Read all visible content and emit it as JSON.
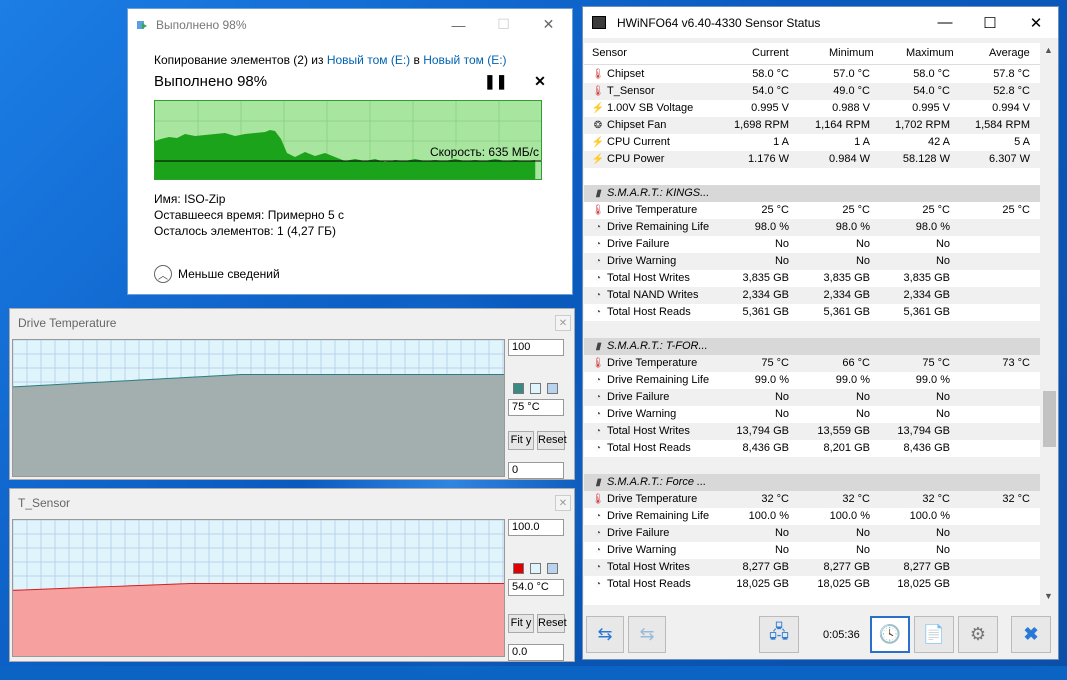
{
  "copy_dialog": {
    "title": "Выполнено 98%",
    "copy_prefix": "Копирование элементов (2) из ",
    "source": "Новый том (E:)",
    "to": " в ",
    "dest": "Новый том (E:)",
    "status": "Выполнено 98%",
    "speed": "Скорость: 635 МБ/с",
    "name_label": "Имя:",
    "name_value": "ISO-Zip",
    "time_label": "Оставшееся время:",
    "time_value": "Примерно 5 с",
    "items_label": "Осталось элементов:",
    "items_value": "1 (4,27 ГБ)",
    "less_details": "Меньше сведений",
    "progress_fraction": 0.98,
    "colors": {
      "fill": "#1ba31b",
      "bg": "#a8e6a0"
    }
  },
  "graph_drive": {
    "title": "Drive Temperature",
    "max": "100",
    "current": "75 °C",
    "min": "0",
    "fit_label": "Fit y",
    "reset_label": "Reset",
    "colors": {
      "fill": "#a3aeae",
      "line": "#2d7f7f",
      "swatch": "#3a8a84"
    }
  },
  "graph_tsensor": {
    "title": "T_Sensor",
    "max": "100.0",
    "current": "54.0 °C",
    "min": "0.0",
    "fit_label": "Fit y",
    "reset_label": "Reset",
    "colors": {
      "fill": "#f7a0a0",
      "line": "#d02020",
      "swatch": "#e00000"
    }
  },
  "hwinfo": {
    "title": "HWiNFO64 v6.40-4330 Sensor Status",
    "columns": [
      "Sensor",
      "Current",
      "Minimum",
      "Maximum",
      "Average"
    ],
    "rows": [
      {
        "icon": "thermometer-icon",
        "name": "Chipset",
        "cur": "58.0 °C",
        "min": "57.0 °C",
        "max": "58.0 °C",
        "avg": "57.8 °C"
      },
      {
        "icon": "thermometer-icon",
        "name": "T_Sensor",
        "cur": "54.0 °C",
        "min": "49.0 °C",
        "max": "54.0 °C",
        "avg": "52.8 °C"
      },
      {
        "icon": "bolt-icon",
        "name": "1.00V SB Voltage",
        "cur": "0.995 V",
        "min": "0.988 V",
        "max": "0.995 V",
        "avg": "0.994 V"
      },
      {
        "icon": "fan-icon",
        "name": "Chipset Fan",
        "cur": "1,698 RPM",
        "min": "1,164 RPM",
        "max": "1,702 RPM",
        "avg": "1,584 RPM"
      },
      {
        "icon": "bolt-icon",
        "name": "CPU Current",
        "cur": "1 A",
        "min": "1 A",
        "max": "42 A",
        "avg": "5 A"
      },
      {
        "icon": "bolt-icon",
        "name": "CPU Power",
        "cur": "1.176 W",
        "min": "0.984 W",
        "max": "58.128 W",
        "avg": "6.307 W"
      },
      {
        "blank": true
      },
      {
        "group": true,
        "icon": "drive-icon",
        "name": "S.M.A.R.T.: KINGS..."
      },
      {
        "icon": "thermometer-icon",
        "name": "Drive Temperature",
        "cur": "25 °C",
        "min": "25 °C",
        "max": "25 °C",
        "avg": "25 °C"
      },
      {
        "icon": "gauge-icon",
        "name": "Drive Remaining Life",
        "cur": "98.0 %",
        "min": "98.0 %",
        "max": "98.0 %",
        "avg": ""
      },
      {
        "icon": "gauge-icon",
        "name": "Drive Failure",
        "cur": "No",
        "min": "No",
        "max": "No",
        "avg": ""
      },
      {
        "icon": "gauge-icon",
        "name": "Drive Warning",
        "cur": "No",
        "min": "No",
        "max": "No",
        "avg": ""
      },
      {
        "icon": "gauge-icon",
        "name": "Total Host Writes",
        "cur": "3,835 GB",
        "min": "3,835 GB",
        "max": "3,835 GB",
        "avg": ""
      },
      {
        "icon": "gauge-icon",
        "name": "Total NAND Writes",
        "cur": "2,334 GB",
        "min": "2,334 GB",
        "max": "2,334 GB",
        "avg": ""
      },
      {
        "icon": "gauge-icon",
        "name": "Total Host Reads",
        "cur": "5,361 GB",
        "min": "5,361 GB",
        "max": "5,361 GB",
        "avg": ""
      },
      {
        "blank": true
      },
      {
        "group": true,
        "icon": "drive-icon",
        "name": "S.M.A.R.T.: T-FOR..."
      },
      {
        "icon": "thermometer-icon",
        "name": "Drive Temperature",
        "cur": "75 °C",
        "min": "66 °C",
        "max": "75 °C",
        "avg": "73 °C"
      },
      {
        "icon": "gauge-icon",
        "name": "Drive Remaining Life",
        "cur": "99.0 %",
        "min": "99.0 %",
        "max": "99.0 %",
        "avg": ""
      },
      {
        "icon": "gauge-icon",
        "name": "Drive Failure",
        "cur": "No",
        "min": "No",
        "max": "No",
        "avg": ""
      },
      {
        "icon": "gauge-icon",
        "name": "Drive Warning",
        "cur": "No",
        "min": "No",
        "max": "No",
        "avg": ""
      },
      {
        "icon": "gauge-icon",
        "name": "Total Host Writes",
        "cur": "13,794 GB",
        "min": "13,559 GB",
        "max": "13,794 GB",
        "avg": ""
      },
      {
        "icon": "gauge-icon",
        "name": "Total Host Reads",
        "cur": "8,436 GB",
        "min": "8,201 GB",
        "max": "8,436 GB",
        "avg": ""
      },
      {
        "blank": true
      },
      {
        "group": true,
        "icon": "drive-icon",
        "name": "S.M.A.R.T.: Force ..."
      },
      {
        "icon": "thermometer-icon",
        "name": "Drive Temperature",
        "cur": "32 °C",
        "min": "32 °C",
        "max": "32 °C",
        "avg": "32 °C"
      },
      {
        "icon": "gauge-icon",
        "name": "Drive Remaining Life",
        "cur": "100.0 %",
        "min": "100.0 %",
        "max": "100.0 %",
        "avg": ""
      },
      {
        "icon": "gauge-icon",
        "name": "Drive Failure",
        "cur": "No",
        "min": "No",
        "max": "No",
        "avg": ""
      },
      {
        "icon": "gauge-icon",
        "name": "Drive Warning",
        "cur": "No",
        "min": "No",
        "max": "No",
        "avg": ""
      },
      {
        "icon": "gauge-icon",
        "name": "Total Host Writes",
        "cur": "8,277 GB",
        "min": "8,277 GB",
        "max": "8,277 GB",
        "avg": ""
      },
      {
        "icon": "gauge-icon",
        "name": "Total Host Reads",
        "cur": "18,025 GB",
        "min": "18,025 GB",
        "max": "18,025 GB",
        "avg": ""
      }
    ],
    "timer": "0:05:36"
  }
}
